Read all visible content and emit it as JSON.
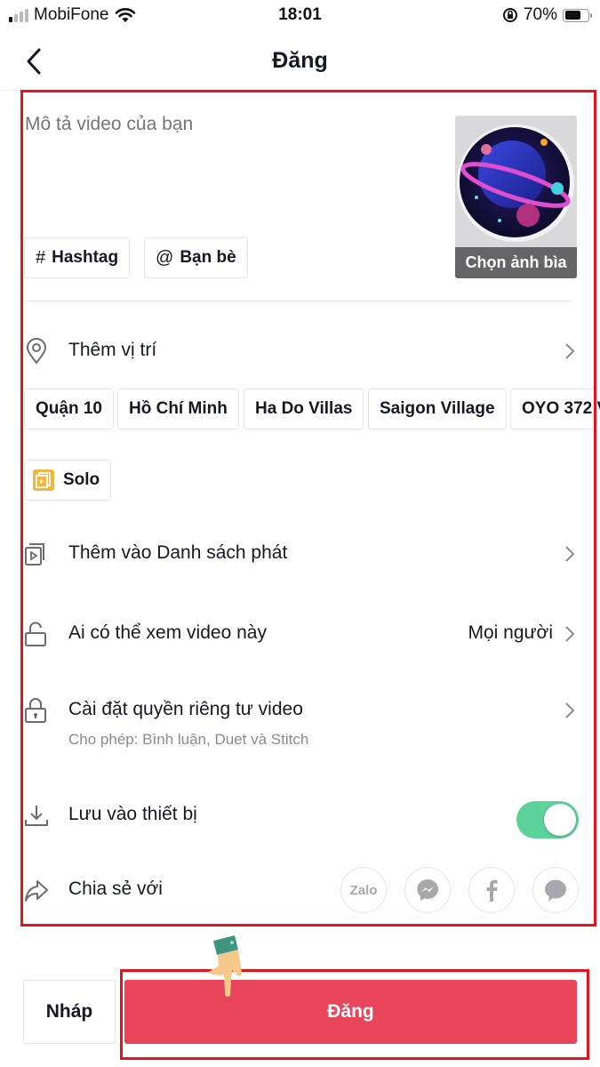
{
  "status_bar": {
    "carrier": "MobiFone",
    "time": "18:01",
    "battery_percent": "70%",
    "battery_level": 0.7,
    "icons": [
      "signal-icon",
      "wifi-icon",
      "rotation-lock-icon",
      "battery-icon"
    ]
  },
  "header": {
    "title": "Đăng",
    "back_icon": "chevron-left-icon"
  },
  "description": {
    "placeholder": "Mô tả video của bạn",
    "value": ""
  },
  "tag_buttons": [
    {
      "symbol": "#",
      "label": "Hashtag"
    },
    {
      "symbol": "@",
      "label": "Bạn bè"
    }
  ],
  "cover": {
    "label": "Chọn ảnh bìa"
  },
  "location": {
    "label": "Thêm vị trí",
    "icon": "location-pin-icon",
    "suggestions": [
      "Quận 10",
      "Hồ Chí Minh",
      "Ha Do Villas",
      "Saigon Village",
      "OYO 372 V"
    ]
  },
  "effect_chip": {
    "label": "Solo"
  },
  "settings": {
    "playlist": {
      "label": "Thêm vào Danh sách phát",
      "icon": "playlist-icon"
    },
    "visibility": {
      "label": "Ai có thể xem video này",
      "value": "Mọi người",
      "icon": "unlock-icon"
    },
    "privacy": {
      "label": "Cài đặt quyền riêng tư video",
      "sub": "Cho phép: Bình luận, Duet và Stitch",
      "icon": "lock-icon"
    },
    "save": {
      "label": "Lưu vào thiết bị",
      "enabled": true,
      "icon": "download-icon"
    },
    "share": {
      "label": "Chia sẻ với",
      "icon": "share-arrow-icon",
      "targets": [
        "Zalo",
        "Messenger",
        "Facebook",
        "Message"
      ]
    }
  },
  "colors": {
    "accent": "#e8445a",
    "toggle_on": "#5cd39a",
    "highlight": "#e8121b"
  },
  "footer": {
    "draft_label": "Nháp",
    "post_label": "Đăng"
  }
}
